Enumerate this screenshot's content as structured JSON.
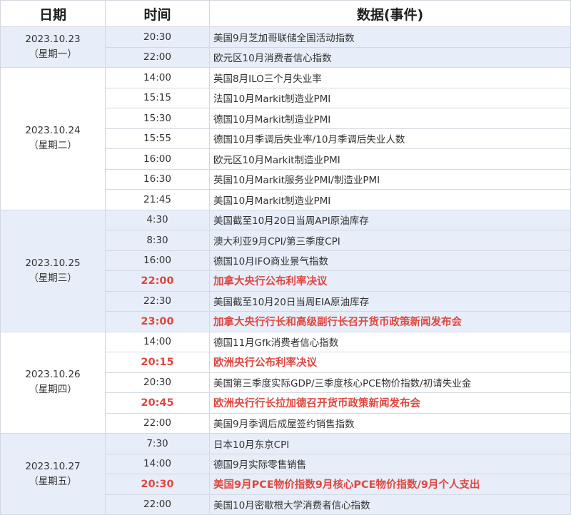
{
  "headers": {
    "date": "日期",
    "time": "时间",
    "event": "数据(事件)"
  },
  "colors": {
    "shade": "#e7eef9",
    "highlight": "#e0483f",
    "border": "#d4d9e0"
  },
  "groups": [
    {
      "date": "2023.10.23",
      "weekday": "（星期一）",
      "shaded": true,
      "rows": [
        {
          "time": "20:30",
          "event": "美国9月芝加哥联储全国活动指数",
          "highlight": false
        },
        {
          "time": "22:00",
          "event": "欧元区10月消费者信心指数",
          "highlight": false
        }
      ]
    },
    {
      "date": "2023.10.24",
      "weekday": "（星期二）",
      "shaded": false,
      "rows": [
        {
          "time": "14:00",
          "event": "英国8月ILO三个月失业率",
          "highlight": false
        },
        {
          "time": "15:15",
          "event": "法国10月Markit制造业PMI",
          "highlight": false
        },
        {
          "time": "15:30",
          "event": "德国10月Markit制造业PMI",
          "highlight": false
        },
        {
          "time": "15:55",
          "event": "德国10月季调后失业率/10月季调后失业人数",
          "highlight": false
        },
        {
          "time": "16:00",
          "event": "欧元区10月Markit制造业PMI",
          "highlight": false
        },
        {
          "time": "16:30",
          "event": "英国10月Markit服务业PMI/制造业PMI",
          "highlight": false
        },
        {
          "time": "21:45",
          "event": "美国10月Markit制造业PMI",
          "highlight": false
        }
      ]
    },
    {
      "date": "2023.10.25",
      "weekday": "（星期三）",
      "shaded": true,
      "rows": [
        {
          "time": "4:30",
          "event": "美国截至10月20日当周API原油库存",
          "highlight": false
        },
        {
          "time": "8:30",
          "event": "澳大利亚9月CPI/第三季度CPI",
          "highlight": false
        },
        {
          "time": "16:00",
          "event": "德国10月IFO商业景气指数",
          "highlight": false
        },
        {
          "time": "22:00",
          "event": "加拿大央行公布利率决议",
          "highlight": true
        },
        {
          "time": "22:30",
          "event": "美国截至10月20日当周EIA原油库存",
          "highlight": false
        },
        {
          "time": "23:00",
          "event": "加拿大央行行长和高级副行长召开货币政策新闻发布会",
          "highlight": true
        }
      ]
    },
    {
      "date": "2023.10.26",
      "weekday": "（星期四）",
      "shaded": false,
      "rows": [
        {
          "time": "14:00",
          "event": "德国11月Gfk消费者信心指数",
          "highlight": false
        },
        {
          "time": "20:15",
          "event": "欧洲央行公布利率决议",
          "highlight": true
        },
        {
          "time": "20:30",
          "event": "美国第三季度实际GDP/三季度核心PCE物价指数/初请失业金",
          "highlight": false
        },
        {
          "time": "20:45",
          "event": "欧洲央行行长拉加德召开货币政策新闻发布会",
          "highlight": true
        },
        {
          "time": "22:00",
          "event": "美国9月季调后成屋签约销售指数",
          "highlight": false
        }
      ]
    },
    {
      "date": "2023.10.27",
      "weekday": "（星期五）",
      "shaded": true,
      "rows": [
        {
          "time": "7:30",
          "event": "日本10月东京CPI",
          "highlight": false
        },
        {
          "time": "14:00",
          "event": "德国9月实际零售销售",
          "highlight": false
        },
        {
          "time": "20:30",
          "event": "美国9月PCE物价指数9月核心PCE物价指数/9月个人支出",
          "highlight": true
        },
        {
          "time": "22:00",
          "event": "美国10月密歇根大学消费者信心指数",
          "highlight": false
        }
      ]
    }
  ]
}
